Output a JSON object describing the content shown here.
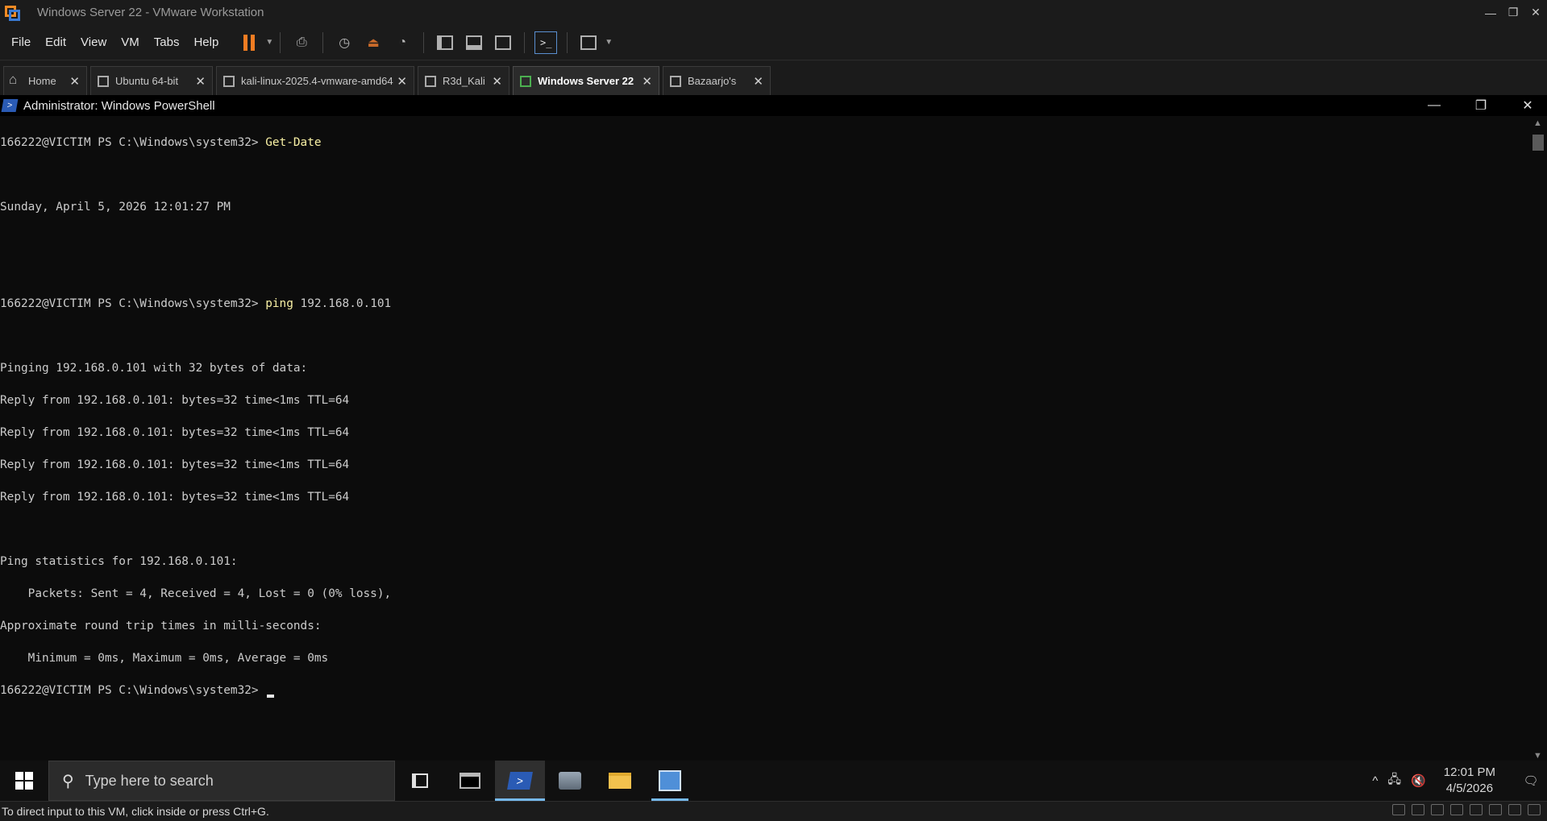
{
  "vmware": {
    "title": "Windows Server 22 - VMware Workstation",
    "window_controls": {
      "minimize": "—",
      "maximize": "❐",
      "close": "✕"
    },
    "menu": [
      "File",
      "Edit",
      "View",
      "VM",
      "Tabs",
      "Help"
    ],
    "tabs": [
      {
        "label": "Home",
        "active": false
      },
      {
        "label": "Ubuntu 64-bit",
        "active": false
      },
      {
        "label": "kali-linux-2025.4-vmware-amd64",
        "active": false
      },
      {
        "label": "R3d_Kali",
        "active": false
      },
      {
        "label": "Windows Server 22",
        "active": true
      },
      {
        "label": "Bazaarjo's",
        "active": false
      }
    ],
    "tab_close": "✕",
    "status_message": "To direct input to this VM, click inside or press Ctrl+G.",
    "accent_color": "#f07c22"
  },
  "powershell": {
    "title": "Administrator: Windows PowerShell",
    "controls": {
      "minimize": "—",
      "maximize": "❐",
      "close": "✕"
    },
    "prompt": "166222@VICTIM PS C:\\Windows\\system32> ",
    "cmd1": "Get-Date",
    "date_output": "Sunday, April 5, 2026 12:01:27 PM",
    "cmd2_name": "ping",
    "cmd2_arg": " 192.168.0.101",
    "ping_lines": [
      "Pinging 192.168.0.101 with 32 bytes of data:",
      "Reply from 192.168.0.101: bytes=32 time<1ms TTL=64",
      "Reply from 192.168.0.101: bytes=32 time<1ms TTL=64",
      "Reply from 192.168.0.101: bytes=32 time<1ms TTL=64",
      "Reply from 192.168.0.101: bytes=32 time<1ms TTL=64"
    ],
    "stats_lines": [
      "Ping statistics for 192.168.0.101:",
      "    Packets: Sent = 4, Received = 4, Lost = 0 (0% loss),",
      "Approximate round trip times in milli-seconds:",
      "    Minimum = 0ms, Maximum = 0ms, Average = 0ms"
    ]
  },
  "taskbar": {
    "search_placeholder": "Type here to search",
    "time": "12:01 PM",
    "date": "4/5/2026",
    "tray_chevron": "^"
  }
}
